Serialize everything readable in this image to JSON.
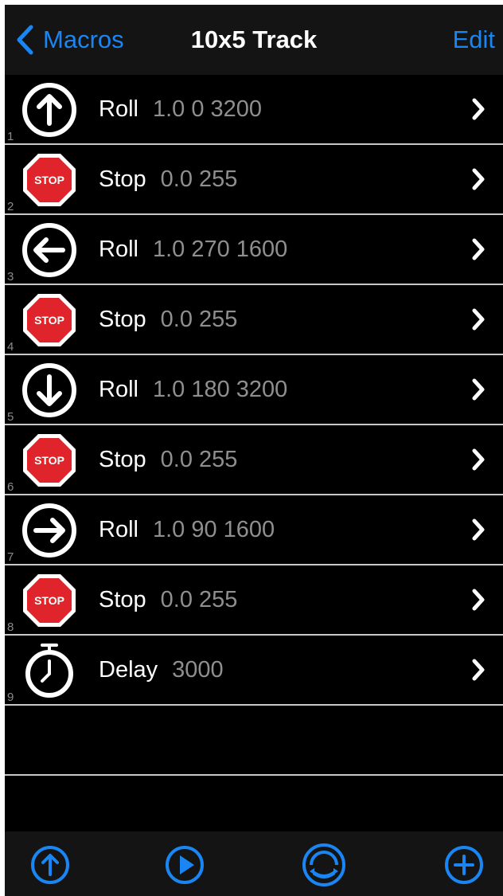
{
  "nav": {
    "back_label": "Macros",
    "title": "10x5 Track",
    "edit_label": "Edit"
  },
  "rows": [
    {
      "num": "1",
      "command": "Roll",
      "params": "1.0 0 3200",
      "icon": "arrow-up-icon"
    },
    {
      "num": "2",
      "command": "Stop",
      "params": "0.0 255",
      "icon": "stop-sign-icon",
      "icon_text": "STOP"
    },
    {
      "num": "3",
      "command": "Roll",
      "params": "1.0 270 1600",
      "icon": "arrow-left-icon"
    },
    {
      "num": "4",
      "command": "Stop",
      "params": "0.0 255",
      "icon": "stop-sign-icon",
      "icon_text": "STOP"
    },
    {
      "num": "5",
      "command": "Roll",
      "params": "1.0 180 3200",
      "icon": "arrow-down-icon"
    },
    {
      "num": "6",
      "command": "Stop",
      "params": "0.0 255",
      "icon": "stop-sign-icon",
      "icon_text": "STOP"
    },
    {
      "num": "7",
      "command": "Roll",
      "params": "1.0 90 1600",
      "icon": "arrow-right-icon"
    },
    {
      "num": "8",
      "command": "Stop",
      "params": "0.0 255",
      "icon": "stop-sign-icon",
      "icon_text": "STOP"
    },
    {
      "num": "9",
      "command": "Delay",
      "params": "3000",
      "icon": "stopwatch-icon"
    }
  ],
  "toolbar": {
    "buttons": [
      "upload-icon",
      "play-icon",
      "robot-icon",
      "add-icon"
    ]
  },
  "colors": {
    "accent": "#1a86f4",
    "stop_red": "#e0242b",
    "background": "#000000",
    "separator": "#c8c8c8",
    "bar": "#141414"
  }
}
